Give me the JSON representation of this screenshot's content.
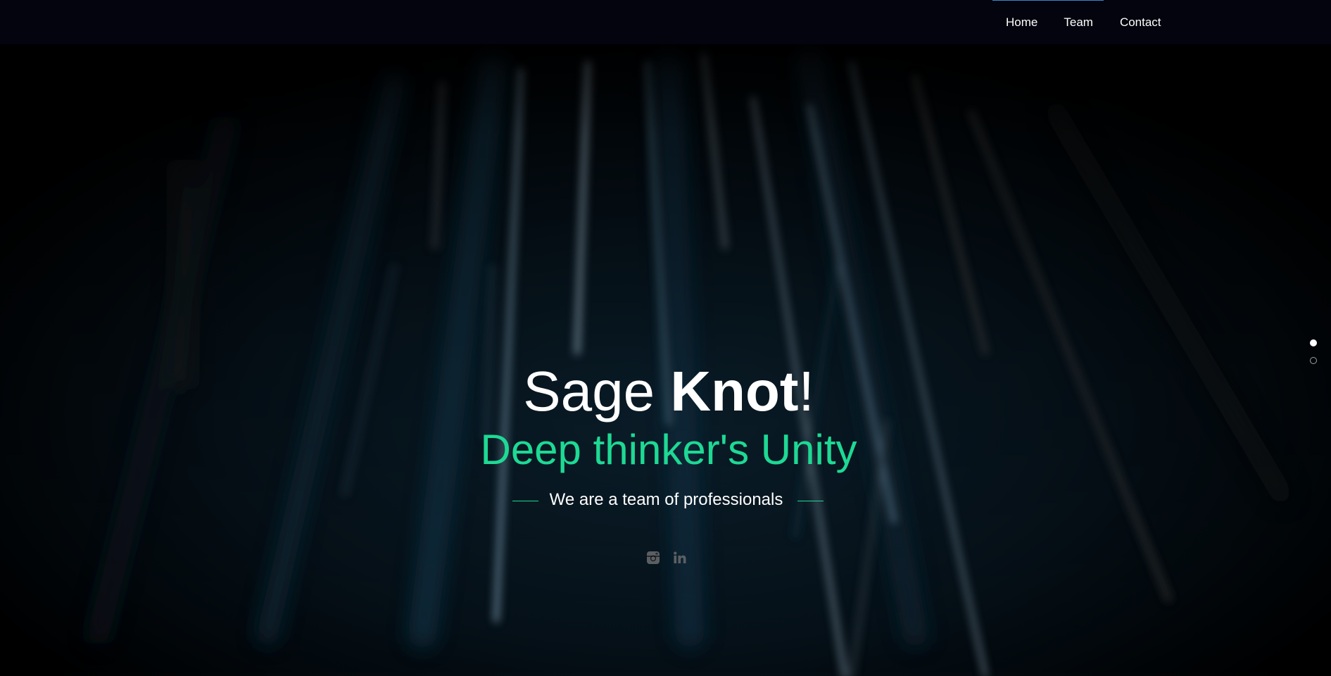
{
  "nav": {
    "items": [
      {
        "label": "Home"
      },
      {
        "label": "Team"
      },
      {
        "label": "Contact"
      }
    ],
    "active_index": 0,
    "indicator_color": "#3a86c8"
  },
  "hero": {
    "title_light": "Sage ",
    "title_bold": "Knot",
    "title_end": "!",
    "subtitle": "Deep thinker's Unity",
    "tagline": "We are a team of professionals",
    "accent_color": "#1ed994"
  },
  "social": [
    {
      "icon": "instagram-icon"
    },
    {
      "icon": "linkedin-icon"
    }
  ],
  "slide_dots": {
    "count": 2,
    "active_index": 0
  }
}
